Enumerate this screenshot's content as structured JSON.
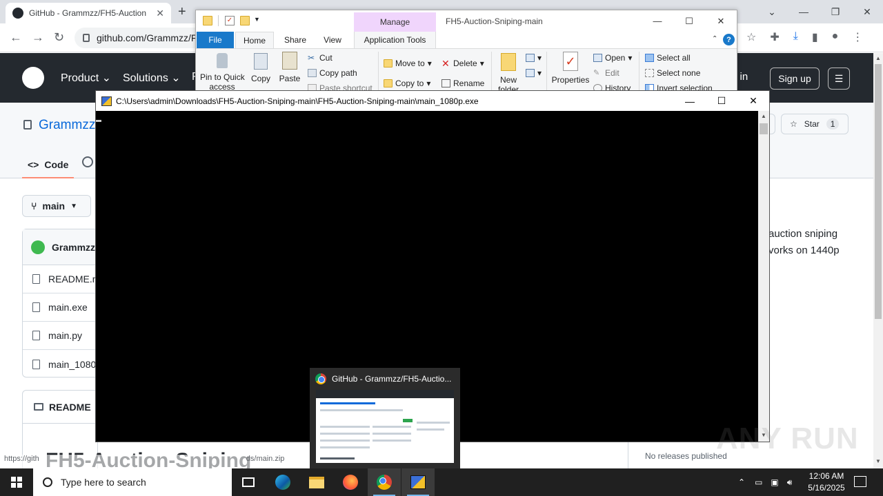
{
  "browser": {
    "tab_title": "GitHub - Grammzz/FH5-Auction",
    "url": "github.com/Grammzz/F",
    "status_url_left": "https://gith",
    "status_url_right": "ds/main.zip"
  },
  "github": {
    "nav": [
      "Product",
      "Solutions",
      "F"
    ],
    "sign_in": "n in",
    "sign_up": "Sign up",
    "repo_owner": "Grammzz",
    "star_label": "Star",
    "star_count": "1",
    "tab_code": "Code",
    "branch": "main",
    "commit_author": "Grammzz",
    "files": [
      "README.m",
      "main.exe",
      "main.py",
      "main_1080"
    ],
    "readme_label": "README",
    "readme_title": "FH5-Auction-Sniping",
    "about_line1": "auction sniping",
    "about_line2": "vorks on 1440p",
    "no_releases": "No releases published"
  },
  "explorer": {
    "context_tab": "Manage",
    "caption": "FH5-Auction-Sniping-main",
    "tabs": {
      "file": "File",
      "home": "Home",
      "share": "Share",
      "view": "View",
      "app_tools": "Application Tools"
    },
    "ribbon": {
      "pin": "Pin to Quick",
      "pin2": "access",
      "copy": "Copy",
      "paste": "Paste",
      "cut": "Cut",
      "copy_path": "Copy path",
      "paste_shortcut": "Paste shortcut",
      "move_to": "Move to",
      "copy_to": "Copy to",
      "delete": "Delete",
      "rename": "Rename",
      "new_folder": "New",
      "new_folder2": "folder",
      "properties": "Properties",
      "open": "Open",
      "edit": "Edit",
      "history": "History",
      "select_all": "Select all",
      "select_none": "Select none",
      "invert_selection": "Invert selection"
    }
  },
  "console": {
    "path": "C:\\Users\\admin\\Downloads\\FH5-Auction-Sniping-main\\FH5-Auction-Sniping-main\\main_1080p.exe"
  },
  "taskbar": {
    "preview_title": "GitHub - Grammzz/FH5-Auctio...",
    "search_placeholder": "Type here to search",
    "time": "12:06 AM",
    "date": "5/16/2025"
  },
  "watermark": "ANY RUN",
  "colors": {
    "github_header": "#24292f",
    "link_blue": "#0969da",
    "ribbon_file_tab": "#1979ca",
    "manage_context": "#f0d5fc",
    "taskbar": "#202020"
  }
}
